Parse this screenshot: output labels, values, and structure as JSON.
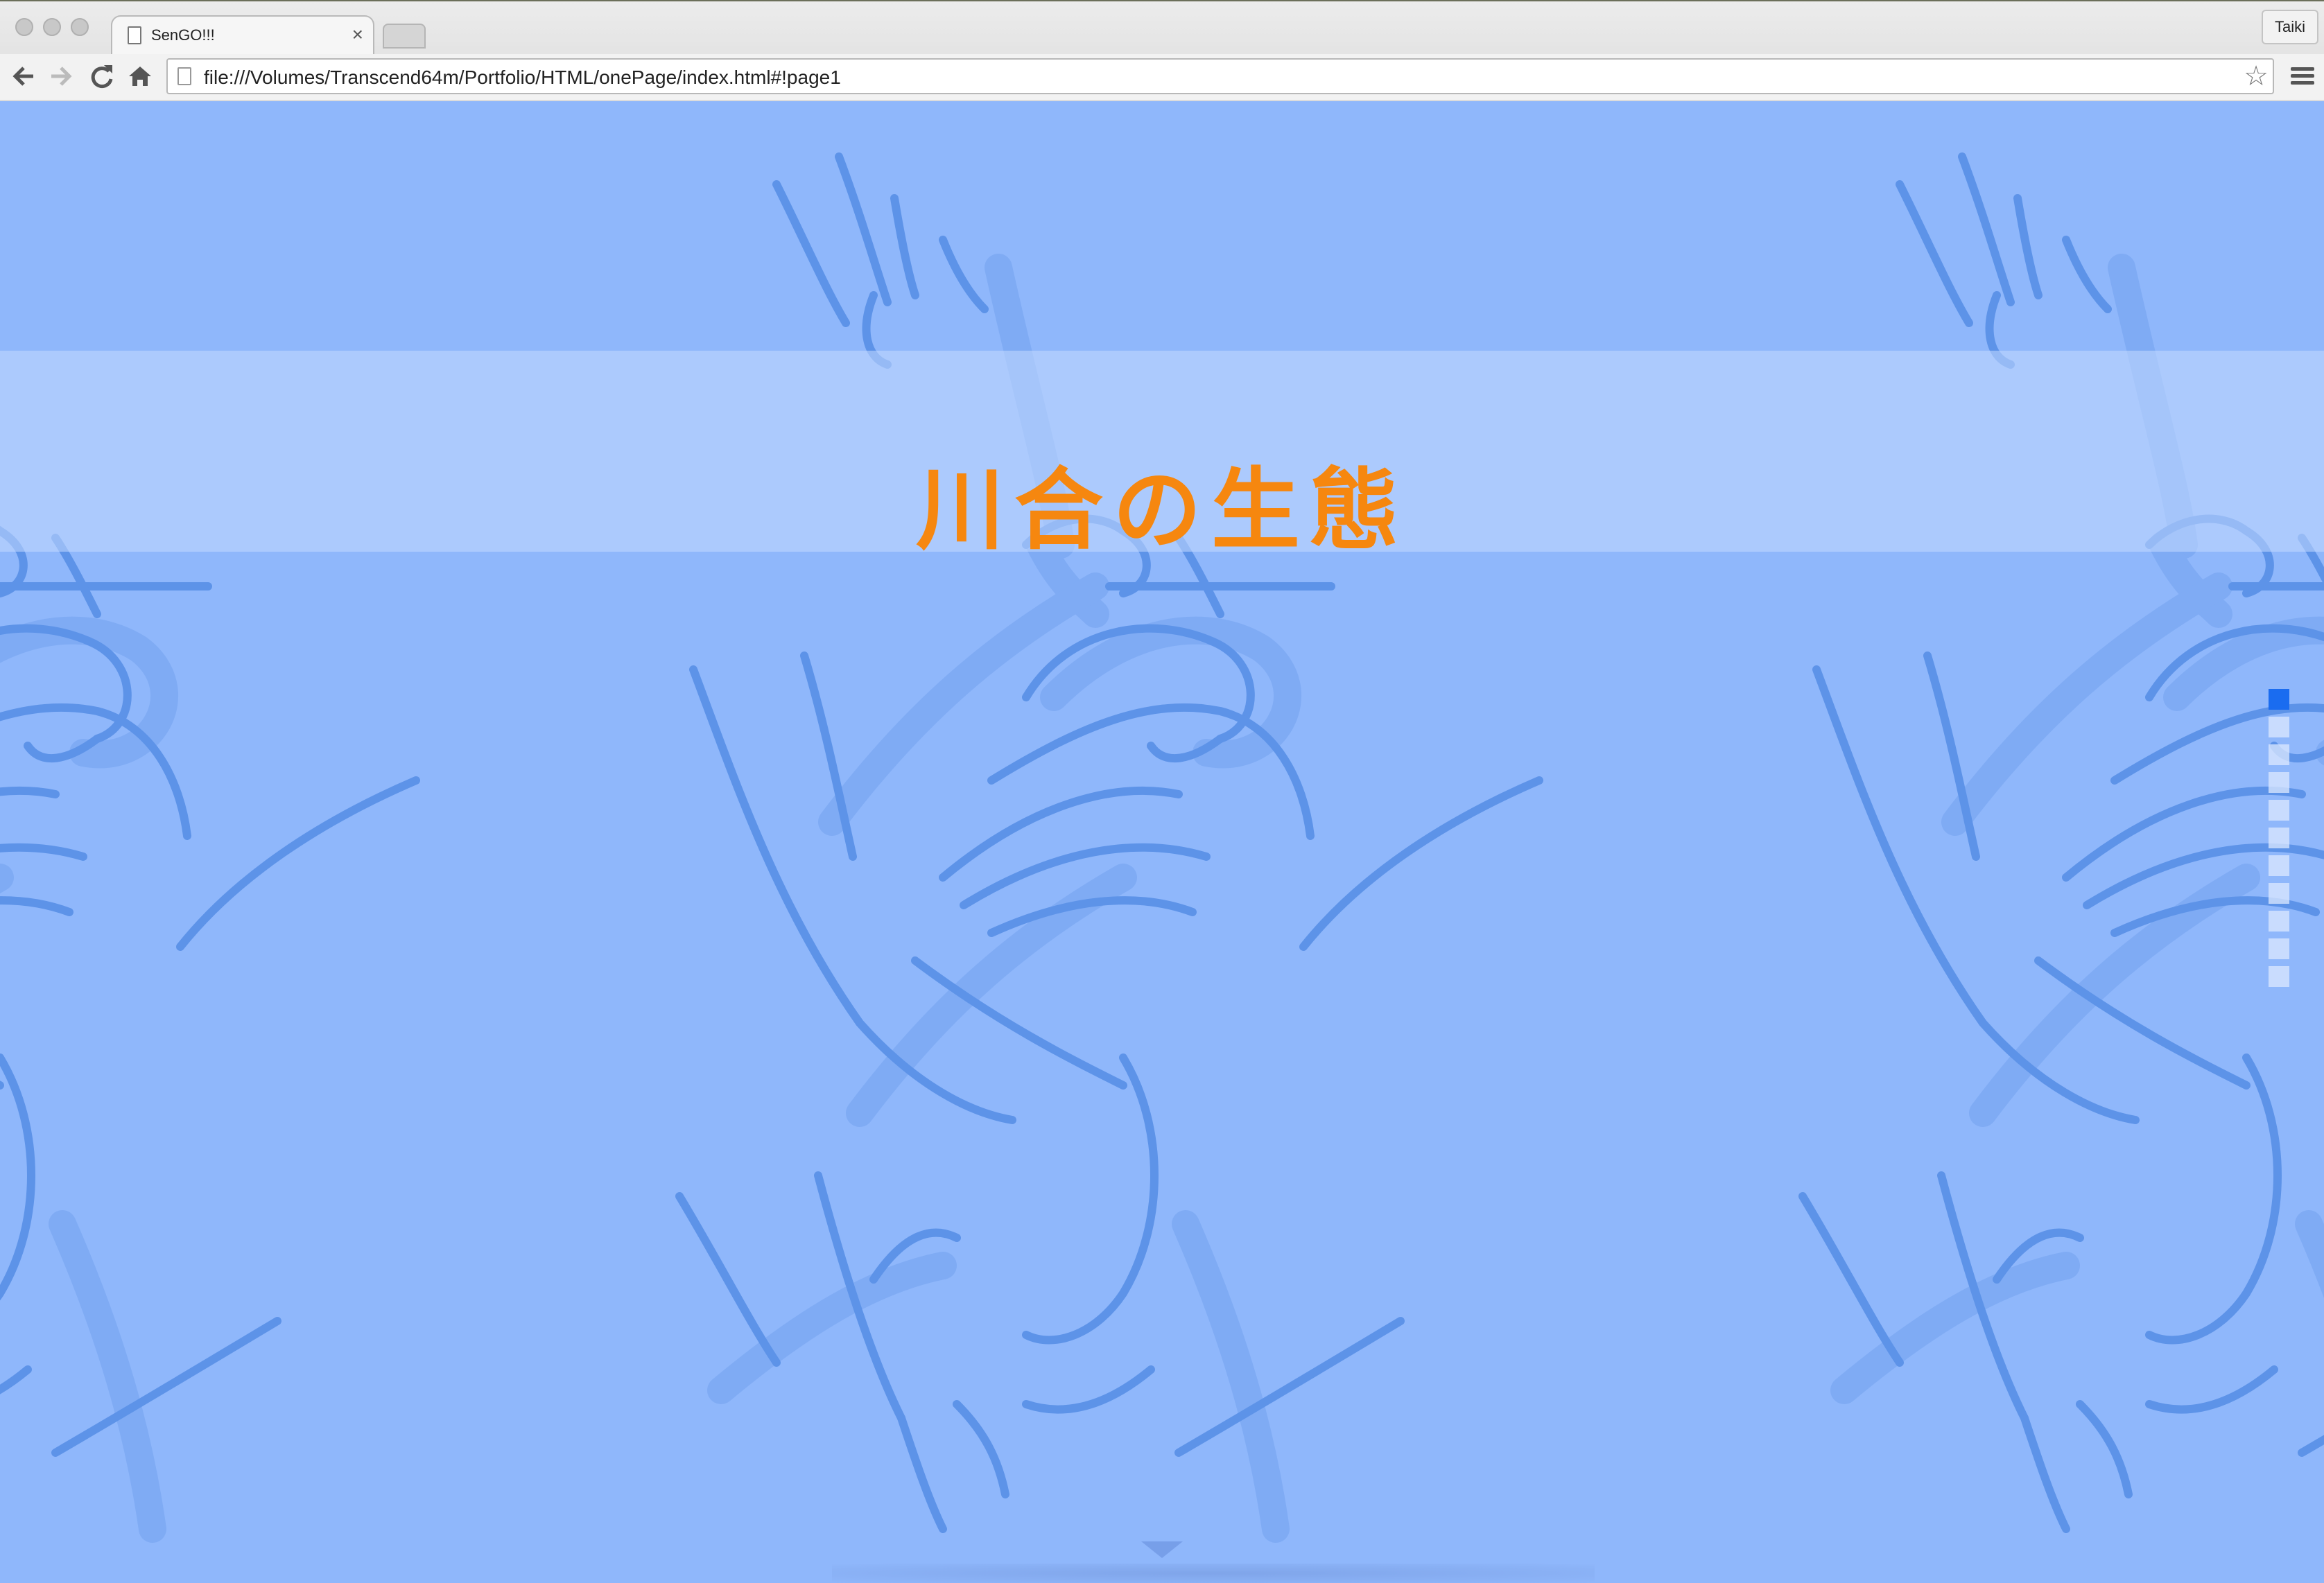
{
  "browser": {
    "tab": {
      "title": "SenGO!!!",
      "close_glyph": "×"
    },
    "profile_name": "Taiki",
    "toolbar": {
      "back_icon": "arrow-left-icon",
      "forward_icon": "arrow-right-icon",
      "reload_icon": "reload-icon",
      "home_icon": "home-icon"
    },
    "address_bar": {
      "url": "file:///Volumes/Transcend64m/Portfolio/HTML/onePage/index.html#!page1"
    },
    "bookmark_icon": "star-icon",
    "menu_icon": "hamburger-menu-icon"
  },
  "page": {
    "heading": "川合の生態",
    "section_nav": {
      "count": 11,
      "active_index": 0
    },
    "scroll_hint_icon": "down-triangle-icon",
    "colors": {
      "background": "#8fb7fb",
      "heading": "#f6870f",
      "sketch_lines": "#5d93e8",
      "active_dot": "#1a6cf0"
    }
  }
}
